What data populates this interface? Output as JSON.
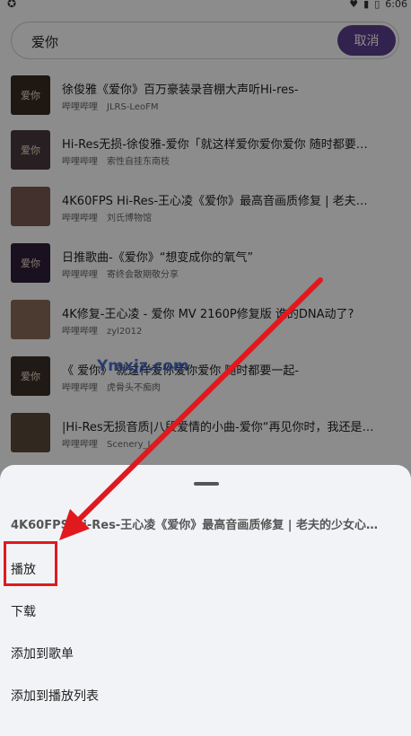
{
  "status_bar": {
    "time": "6:06"
  },
  "search": {
    "query": "爱你",
    "cancel_label": "取消"
  },
  "results": [
    {
      "title": "徐俊雅《爱你》百万豪装录音棚大声听Hi-res-",
      "source": "哔哩哔哩",
      "author": "JLRS-LeoFM",
      "thumb_text": "爱你",
      "thumb_color": "#3a2a22"
    },
    {
      "title": "Hi-Res无损-徐俊雅-爱你「就这样爱你爱你爱你 随时都要…",
      "source": "哔哩哔哩",
      "author": "索性自挂东南枝",
      "thumb_text": "爱你",
      "thumb_color": "#4a3a3f"
    },
    {
      "title": "4K60FPS Hi-Res-王心凌《爱你》最高音画质修复 | 老夫…",
      "source": "哔哩哔哩",
      "author": "刘氏博物馆",
      "thumb_text": "",
      "thumb_color": "#7a5a52"
    },
    {
      "title": "日推歌曲-《爱你》“想变成你的氧气”",
      "source": "哔哩哔哩",
      "author": "寄终会散期敬分享",
      "thumb_text": "爱你",
      "thumb_color": "#2e1f3a"
    },
    {
      "title": "4K修复-王心凌 - 爱你 MV 2160P修复版 谁的DNA动了?",
      "source": "哔哩哔哩",
      "author": "zyl2012",
      "thumb_text": "",
      "thumb_color": "#8a6c5a"
    },
    {
      "title": "《 爱你》 就这样爱你爱你爱你 随时都要一起-",
      "source": "哔哩哔哩",
      "author": "虎骨头不痴肉",
      "thumb_text": "爱你",
      "thumb_color": "#3b302a"
    },
    {
      "title": "|Hi-Res无损音质|八段爱情的小曲-爱你“再见你时，我还是…",
      "source": "哔哩哔哩",
      "author": "Scenery_J",
      "thumb_text": "",
      "thumb_color": "#5a4a3a"
    }
  ],
  "sheet": {
    "title": "4K60FPS Hi-Res-王心凌《爱你》最高音画质修复 | 老夫的少女心…",
    "actions": [
      "播放",
      "下载",
      "添加到歌单",
      "添加到播放列表"
    ]
  },
  "watermark": "Ymxjz.com",
  "colors": {
    "accent": "#5a3f8e",
    "annotation": "#e0191f",
    "watermark": "#2f5ac8"
  }
}
